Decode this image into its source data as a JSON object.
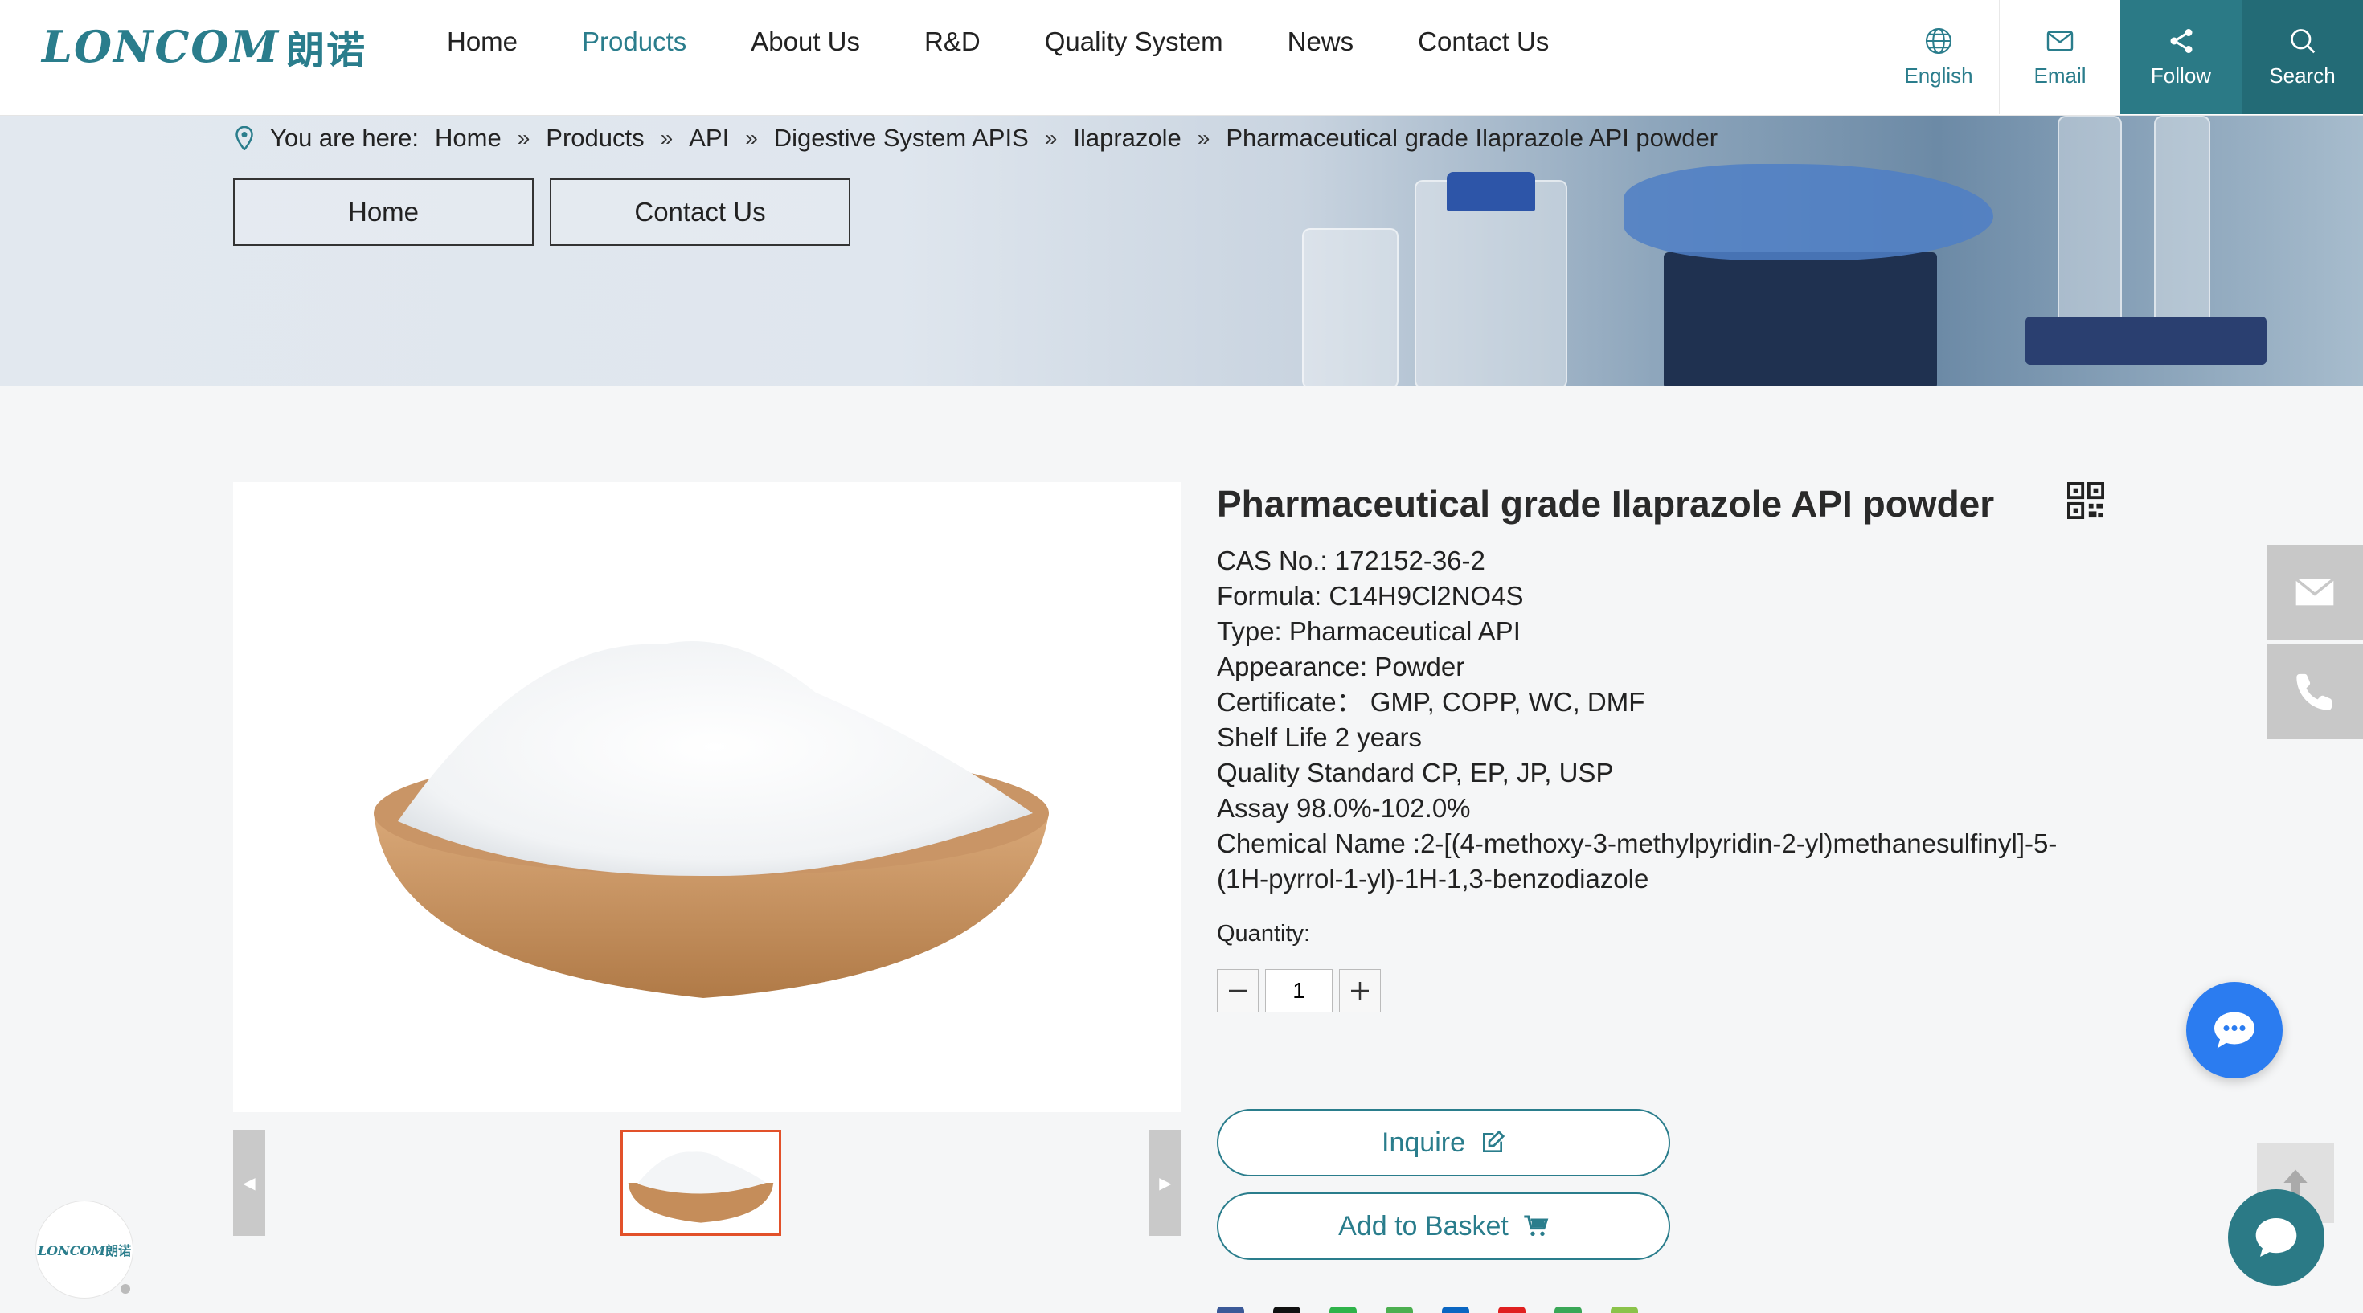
{
  "logo": {
    "en": "LONCOM",
    "cn": "朗诺"
  },
  "nav": {
    "items": [
      {
        "label": "Home"
      },
      {
        "label": "Products"
      },
      {
        "label": "About Us"
      },
      {
        "label": "R&D"
      },
      {
        "label": "Quality System"
      },
      {
        "label": "News"
      },
      {
        "label": "Contact Us"
      }
    ],
    "active": "Products"
  },
  "tools": {
    "language": "English",
    "email": "Email",
    "follow": "Follow",
    "search": "Search"
  },
  "breadcrumb": {
    "prefix": "You are here:",
    "items": [
      "Home",
      "Products",
      "API",
      "Digestive System APIS",
      "Ilaprazole",
      "Pharmaceutical grade Ilaprazole API powder"
    ],
    "separator": "»"
  },
  "banner_buttons": {
    "home": "Home",
    "contact": "Contact Us"
  },
  "product": {
    "title": "Pharmaceutical grade Ilaprazole API powder",
    "specs": [
      "CAS No.: 172152-36-2",
      "Formula: C14H9Cl2NO4S",
      "Type: Pharmaceutical API",
      "Appearance: Powder",
      "Certificate：  GMP, COPP, WC, DMF",
      "Shelf Life 2 years",
      "Quality Standard CP, EP, JP, USP",
      "Assay 98.0%-102.0%",
      "Chemical Name :2-[(4-methoxy-3-methylpyridin-2-yl)methanesulfinyl]-5-(1H-pyrrol-1-yl)-1H-1,3-benzodiazole"
    ],
    "quantity_label": "Quantity:",
    "quantity_value": "1",
    "inquire_label": "Inquire",
    "basket_label": "Add to Basket"
  },
  "colors": {
    "brand": "#2a7d8c",
    "thumb_border": "#e2512a",
    "chat_blue": "#2b7cf0"
  }
}
